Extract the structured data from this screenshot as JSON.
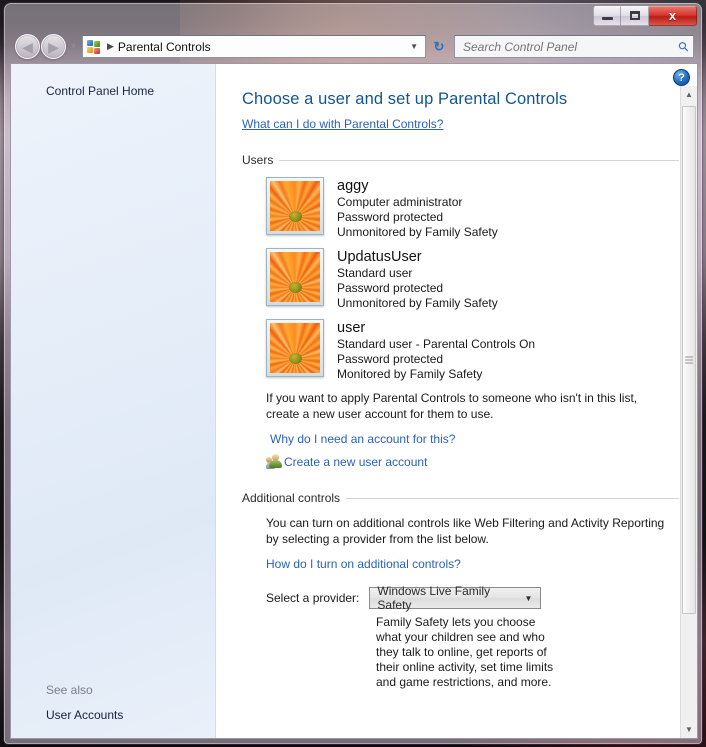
{
  "window": {
    "minimize_label": "Minimize",
    "maximize_label": "Maximize",
    "close_label": "x"
  },
  "navbar": {
    "back_label": "◀",
    "forward_label": "▶",
    "history_label": "▼",
    "breadcrumb_separator": "▶",
    "breadcrumb": "Parental Controls",
    "address_dropdown_label": "▼",
    "refresh_label": "↻",
    "search_value": "",
    "search_placeholder": "Search Control Panel",
    "search_icon_label": "⚲"
  },
  "sidebar": {
    "home_label": "Control Panel Home",
    "see_also_label": "See also",
    "user_accounts_label": "User Accounts"
  },
  "content": {
    "page_title": "Choose a user and set up Parental Controls",
    "intro_link": "What can I do with Parental Controls?",
    "users_section_label": "Users",
    "users": [
      {
        "name": "aggy",
        "account_type": "Computer administrator",
        "password": "Password protected",
        "monitoring": "Unmonitored by Family Safety"
      },
      {
        "name": "UpdatusUser",
        "account_type": "Standard user",
        "password": "Password protected",
        "monitoring": "Unmonitored by Family Safety"
      },
      {
        "name": "user",
        "account_type": "Standard user - Parental Controls On",
        "password": "Password protected",
        "monitoring": "Monitored by Family Safety"
      }
    ],
    "apply_note": "If you want to apply Parental Controls to someone who isn't in this list, create a new user account for them to use.",
    "why_link": "Why do I need an account for this?",
    "create_account_link": "Create a new user account",
    "additional_section_label": "Additional controls",
    "additional_note": "You can turn on additional controls like Web Filtering and Activity Reporting by selecting a provider from the list below.",
    "how_link": "How do I turn on additional controls?",
    "provider_label": "Select a provider:",
    "provider_value": "Windows Live Family Safety",
    "provider_caret": "▼",
    "provider_description": "Family Safety lets you choose what your children see and who they talk to online, get reports of their online activity, set time limits and game restrictions, and more."
  },
  "help": {
    "button_label": "?"
  },
  "scrollbar": {
    "up_label": "▲",
    "down_label": "▼"
  },
  "colors": {
    "title": "#14558f",
    "link": "#2a62b8",
    "close_button": "#d7352b"
  }
}
